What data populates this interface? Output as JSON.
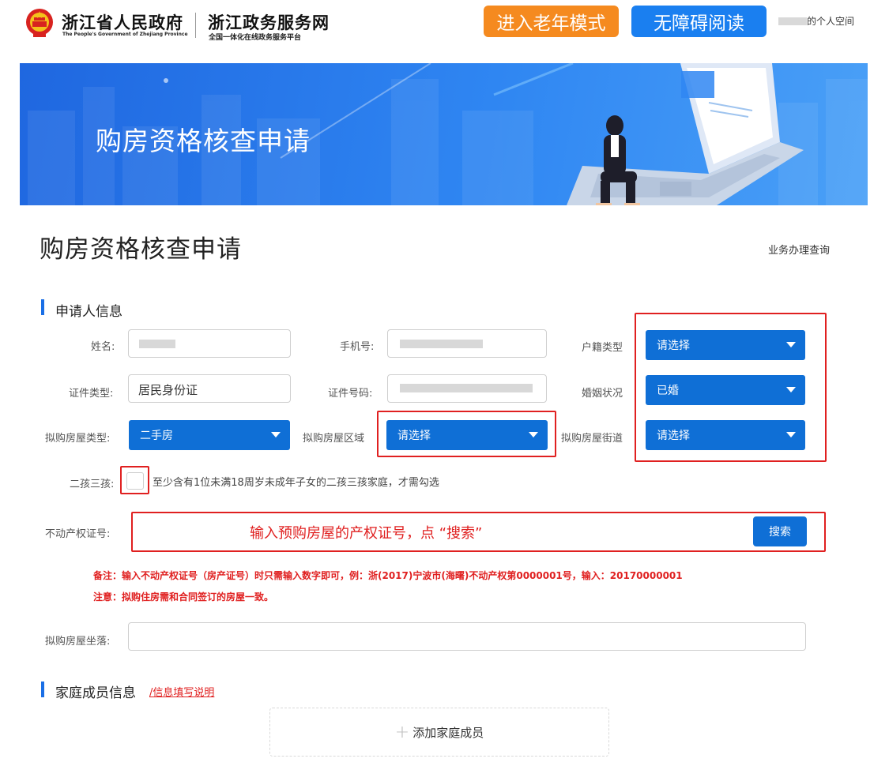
{
  "header": {
    "gov_name": "浙江省人民政府",
    "gov_subtitle": "The People's Government of Zhejiang Province",
    "portal_name": "浙江政务服务网",
    "portal_subtitle": "全国一体化在线政务服务平台",
    "elder_mode_label": "进入老年模式",
    "accessible_label": "无障碍阅读",
    "personal_space_label": "的个人空间"
  },
  "banner": {
    "title": "购房资格核查申请"
  },
  "page": {
    "title": "购房资格核查申请",
    "query_link": "业务办理查询"
  },
  "applicant": {
    "section_title": "申请人信息",
    "name_label": "姓名:",
    "phone_label": "手机号:",
    "hukou_label": "户籍类型",
    "hukou_value": "请选择",
    "id_type_label": "证件类型:",
    "id_type_value": "居民身份证",
    "id_number_label": "证件号码:",
    "marital_label": "婚姻状况",
    "marital_value": "已婚",
    "house_type_label": "拟购房屋类型:",
    "house_type_value": "二手房",
    "house_region_label": "拟购房屋区域",
    "house_region_value": "请选择",
    "house_street_label": "拟购房屋街道",
    "house_street_value": "请选择",
    "second_third_child_label": "二孩三孩:",
    "second_third_child_hint": "至少含有1位未满18周岁未成年子女的二孩三孩家庭，才需勾选",
    "cert_number_label": "不动产权证号:",
    "cert_number_hint": "输入预购房屋的产权证号，点 “搜索”",
    "search_button": "搜索",
    "note1": "备注：输入不动产权证号（房产证号）时只需输入数字即可，例：浙(2017)宁波市(海曙)不动产权第0000001号，输入：20170000001",
    "note2": "注意：拟购住房需和合同签订的房屋一致。",
    "house_location_label": "拟购房屋坐落:"
  },
  "family": {
    "section_title": "家庭成员信息",
    "instructions_link": "/信息填写说明",
    "add_member_label": "添加家庭成员"
  },
  "colors": {
    "primary_blue": "#0f6fd6",
    "elder_orange": "#f58a1f",
    "access_blue": "#1a7ff0",
    "annotation_red": "#e02020"
  }
}
